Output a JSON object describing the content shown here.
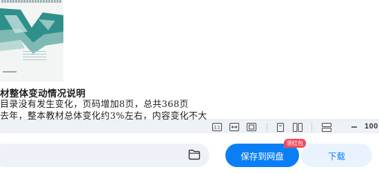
{
  "document": {
    "heading": "材整体变动情况说明",
    "lines": [
      "目录没有发生变化，页码增加8页，总共368页",
      "去年，整本教材总体变化约3%左右，内容变化不大"
    ]
  },
  "viewer_toolbar": {
    "actual_size_label": "1:1",
    "zoom_percent": "100"
  },
  "actions": {
    "save_label": "保存到网盘",
    "save_badge": "领红包",
    "download_label": "下载"
  },
  "colors": {
    "primary": "#0a7ff5",
    "badge": "#f04b5c",
    "cover_teal": "#2a8a86"
  }
}
